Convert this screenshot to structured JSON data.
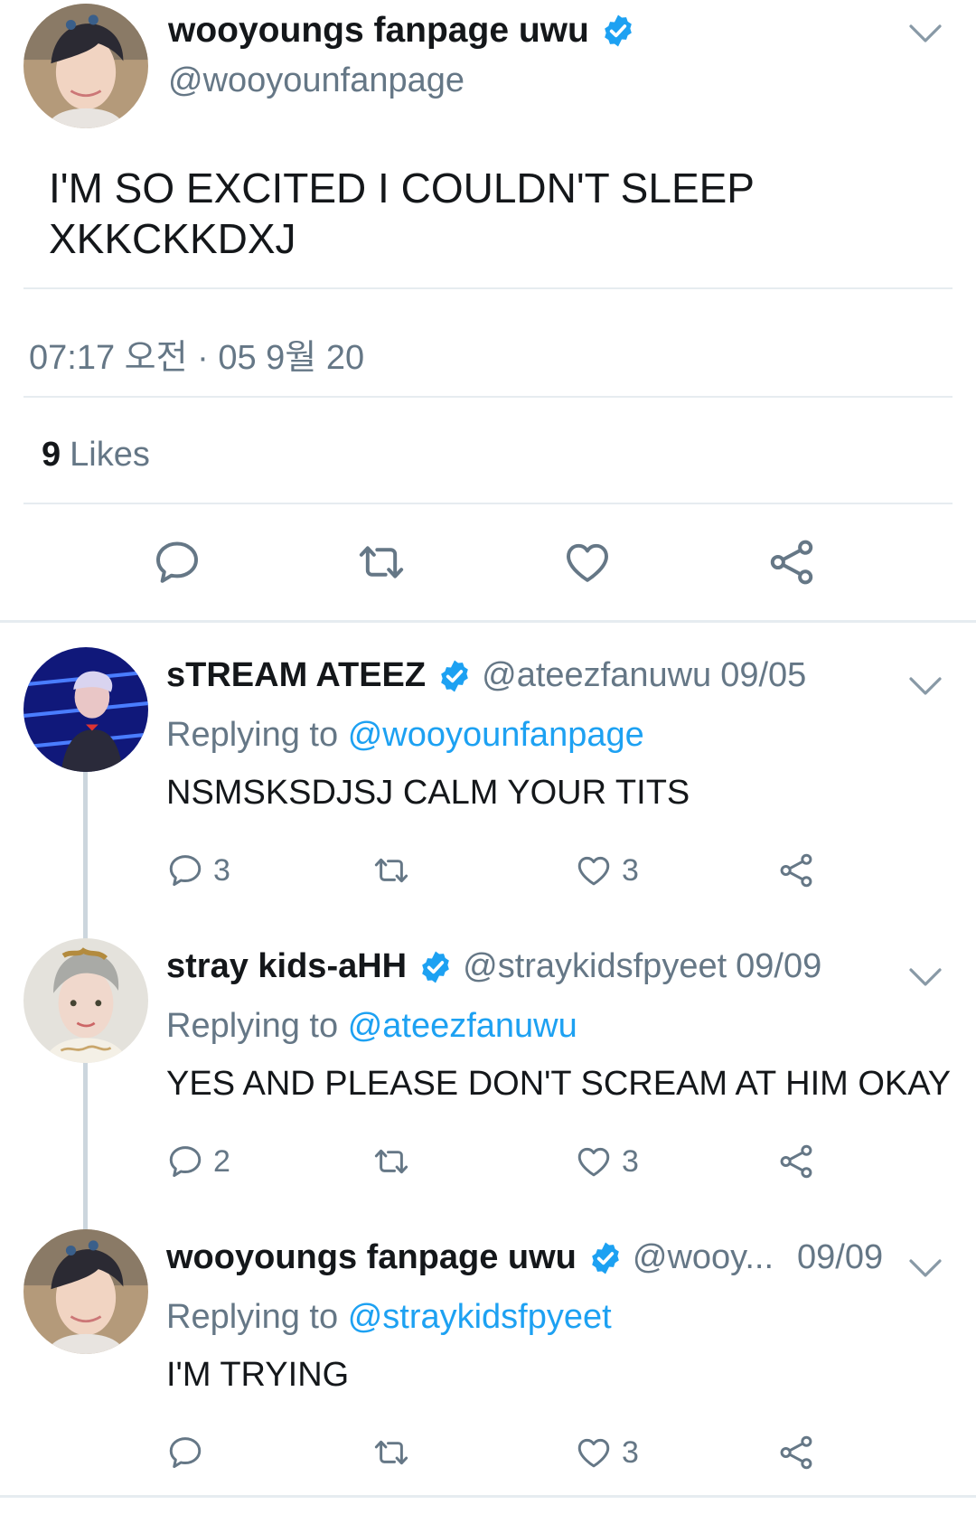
{
  "main_tweet": {
    "display_name": "wooyoungs fanpage uwu",
    "handle": "@wooyounfanpage",
    "text": "I'M SO EXCITED I COULDN'T SLEEP XKKCKKDXJ",
    "timestamp": "07:17 오전 · 05 9월 20",
    "likes_count": "9",
    "likes_label": "Likes",
    "actions": [
      "reply-icon",
      "retweet-icon",
      "like-icon",
      "share-icon"
    ]
  },
  "replies": [
    {
      "display_name": "sTREAM ATEEZ",
      "handle": "@ateezfanuwu",
      "date": "09/05",
      "replying_prefix": "Replying to",
      "replying_to": "@wooyounfanpage",
      "text": "NSMSKSDJSJ CALM YOUR TITS",
      "reply_count": "3",
      "retweet_count": "",
      "like_count": "3"
    },
    {
      "display_name": "stray kids-aHH",
      "handle": "@straykidsfpyeet",
      "date": "09/09",
      "replying_prefix": "Replying to",
      "replying_to": "@ateezfanuwu",
      "text": "YES AND PLEASE DON'T SCREAM AT HIM OKAY",
      "reply_count": "2",
      "retweet_count": "",
      "like_count": "3"
    },
    {
      "display_name": "wooyoungs fanpage uwu",
      "handle": "@wooy...",
      "date": "09/09",
      "replying_prefix": "Replying to",
      "replying_to": "@straykidsfpyeet",
      "text": "I'M TRYING",
      "reply_count": "",
      "retweet_count": "",
      "like_count": "3"
    }
  ],
  "colors": {
    "text": "#14171a",
    "secondary": "#657786",
    "link": "#1da1f2",
    "verified": "#1da1f2",
    "divider": "#e6ecf0",
    "thread_line": "#ccd6dd"
  }
}
